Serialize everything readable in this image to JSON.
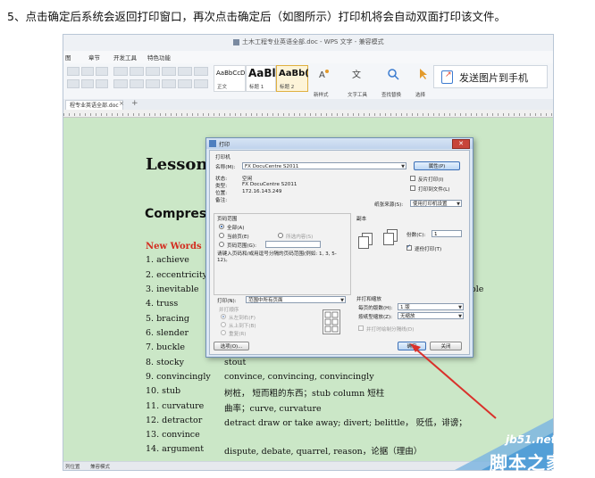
{
  "step": "5、点击确定后系统会返回打印窗口，再次点击确定后（如图所示）打印机将会自动双面打印该文件。",
  "window": {
    "title": "土木工程专业英语全部.doc - WPS 文字 - 兼容模式"
  },
  "menu": [
    "图",
    "章节",
    "开发工具",
    "特色功能"
  ],
  "ribbon": {
    "styles": [
      {
        "sample": "AaBbCcD",
        "caption": "正文"
      },
      {
        "sample": "AaBl",
        "caption": "标题 1"
      },
      {
        "sample": "AaBb(",
        "caption": "标题 2"
      }
    ],
    "new_style": "新样式",
    "text_tools": "文字工具",
    "find_replace": "查找替换",
    "select": "选择",
    "send_to_phone": "发送图片到手机"
  },
  "tab": {
    "label": "程专业英语全部.doc",
    "close": "×",
    "plus": "+"
  },
  "document": {
    "heading": "Lesson",
    "subheading": "Compres",
    "section": "New Words",
    "words": [
      {
        "term": "1. achieve",
        "def": ""
      },
      {
        "term": "2. eccentricity",
        "def": ""
      },
      {
        "term": "3. inevitable",
        "def": ""
      },
      {
        "term": "4. truss",
        "def": ""
      },
      {
        "term": "5. bracing",
        "def": ""
      },
      {
        "term": "6. slender",
        "def": ""
      },
      {
        "term": "7. buckle",
        "def": ""
      },
      {
        "term": "8. stocky",
        "def": "stout"
      },
      {
        "term": "9. convincingly",
        "def": "convince, convincing, convincingly"
      },
      {
        "term": "10. stub",
        "def": "树桩，    短而粗的东西；stub column  短柱"
      },
      {
        "term": "11. curvature",
        "def": "曲率；curve, curvature"
      },
      {
        "term": "12. detractor",
        "def": "detract    draw or take away; divert; belittle，    贬低，诽谤；"
      },
      {
        "term": "13. convince",
        "def": ""
      },
      {
        "term": "14. argument",
        "def": "dispute, debate, quarrel, reason，论据（理由）"
      }
    ],
    "right_fragment": "able"
  },
  "status": {
    "left": "列位置",
    "mode": "兼容模式"
  },
  "print_dialog": {
    "title": "打印",
    "close": "✕",
    "printer_section": "打印机",
    "name_label": "名称(M):",
    "printer_name": "FX DocuCentre S2011",
    "properties": "属性(P)",
    "status_label": "状态:",
    "status_value": "空闲",
    "type_label": "类型:",
    "type_value": "FX DocuCentre S2011",
    "where_label": "位置:",
    "where_value": "172.16.143.249",
    "comment_label": "备注:",
    "reverse_print": "反片打印(I)",
    "print_to_file": "打印到文件(L)",
    "paper_source_label": "纸张来源(S):",
    "paper_source": "使用打印机设置",
    "range_section": "页码范围",
    "range_all": "全部(A)",
    "range_current": "当前页(E)",
    "range_selection": "所选内容(S)",
    "range_pages": "页码范围(G):",
    "range_hint": "请键入页码和/或用逗号分隔的页码范围(例如: 1, 3, 5-12)。",
    "copies_section": "副本",
    "copies_label": "份数(C):",
    "copies_value": "1",
    "collate": "逐份打印(T)",
    "print_label": "打印(N):",
    "print_value": "范围中所有页面",
    "print_order": "并打顺序",
    "order_lr": "从左到右(F)",
    "order_tb": "从上到下(B)",
    "order_repeat": "重复(R)",
    "zoom_section": "并打和缩放",
    "pages_per_sheet_label": "每页的版数(H):",
    "pages_per_sheet": "1 版",
    "scale_label": "按纸型缩放(Z):",
    "scale_value": "无缩放",
    "draw_border": "并打时绘制分隔线(D)",
    "options": "选项(O)...",
    "ok": "确定",
    "cancel": "关闭"
  },
  "watermark": {
    "site": "jb51.net",
    "name": "脚本之家"
  },
  "colors": {
    "doc_background": "#cbe7c7",
    "new_words_red": "#d32b1e",
    "arrow_red": "#d9312b"
  }
}
